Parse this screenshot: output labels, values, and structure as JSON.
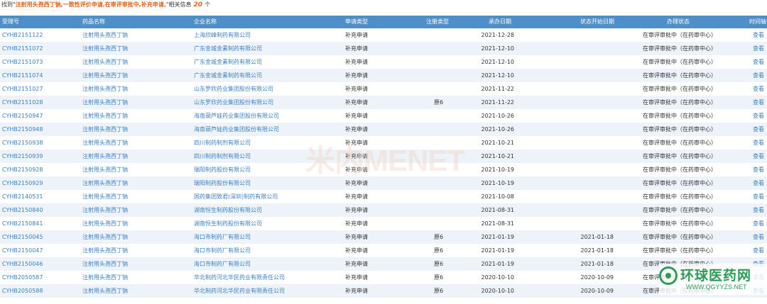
{
  "summary": {
    "prefix": "找到\"",
    "query": "注射用头孢西丁钠,一致性评价申请,在审评审批中,补充申请,",
    "suffix": "\"相关信息",
    "count": "20",
    "unit": "个"
  },
  "table": {
    "headers": [
      "受理号",
      "药品名称",
      "企业名称",
      "申请类型",
      "注册类型",
      "承办日期",
      "状态开始日期",
      "办理状态",
      "时间轴"
    ],
    "rows": [
      [
        "CYHB2151122",
        "注射用头孢西丁钠",
        "上海欣峰制药有限公司",
        "补充申请",
        "",
        "2021-12-28",
        "",
        "在审评审批中（在药审中心）",
        "查看"
      ],
      [
        "CYHB2151072",
        "注射用头孢西丁钠",
        "广东金城金素制药有限公司",
        "补充申请",
        "",
        "2021-12-10",
        "",
        "在审评审批中（在药审中心）",
        "查看"
      ],
      [
        "CYHB2151073",
        "注射用头孢西丁钠",
        "广东金城金素制药有限公司",
        "补充申请",
        "",
        "2021-12-10",
        "",
        "在审评审批中（在药审中心）",
        "查看"
      ],
      [
        "CYHB2151074",
        "注射用头孢西丁钠",
        "广东金城金素制药有限公司",
        "补充申请",
        "",
        "2021-12-10",
        "",
        "在审评审批中（在药审中心）",
        "查看"
      ],
      [
        "CYHB2151027",
        "注射用头孢西丁钠",
        "山东罗欣药业集团股份有限公司",
        "补充申请",
        "",
        "2021-11-22",
        "",
        "在审评审批中（在药审中心）",
        "查看"
      ],
      [
        "CYHB2151028",
        "注射用头孢西丁钠",
        "山东罗欣药业集团股份有限公司",
        "补充申请",
        "原6",
        "2021-11-22",
        "",
        "在审评审批中（在药审中心）",
        "查看"
      ],
      [
        "CYHB2150947",
        "注射用头孢西丁钠",
        "海南葫芦娃药业集团股份有限公司",
        "补充申请",
        "",
        "2021-10-26",
        "",
        "在审评审批中（在药审中心）",
        "查看"
      ],
      [
        "CYHB2150948",
        "注射用头孢西丁钠",
        "海南葫芦娃药业集团股份有限公司",
        "补充申请",
        "",
        "2021-10-26",
        "",
        "在审评审批中（在药审中心）",
        "查看"
      ],
      [
        "CYHB2150938",
        "注射用头孢西丁钠",
        "四川制药制剂有限公司",
        "补充申请",
        "",
        "2021-10-21",
        "",
        "在审评审批中（在药审中心）",
        "查看"
      ],
      [
        "CYHB2150939",
        "注射用头孢西丁钠",
        "四川制药制剂有限公司",
        "补充申请",
        "",
        "2021-10-21",
        "",
        "在审评审批中（在药审中心）",
        "查看"
      ],
      [
        "CYHB2150928",
        "注射用头孢西丁钠",
        "瑞阳制药股份有限公司",
        "补充申请",
        "",
        "2021-10-19",
        "",
        "在审评审批中（在药审中心）",
        "查看"
      ],
      [
        "CYHB2150929",
        "注射用头孢西丁钠",
        "瑞阳制药股份有限公司",
        "补充申请",
        "",
        "2021-10-19",
        "",
        "在审评审批中（在药审中心）",
        "查看"
      ],
      [
        "CYHB2140531",
        "注射用头孢西丁钠",
        "国药集团致君(深圳)制药有限公司",
        "补充申请",
        "",
        "2021-10-08",
        "",
        "在审评审批中（在药审中心）",
        "查看"
      ],
      [
        "CYHB2150840",
        "注射用头孢西丁钠",
        "湖南恒生制药股份有限公司",
        "补充申请",
        "",
        "2021-08-31",
        "",
        "在审评审批中（在药审中心）",
        "查看"
      ],
      [
        "CYHB2150841",
        "注射用头孢西丁钠",
        "湖南恒生制药股份有限公司",
        "补充申请",
        "",
        "2021-08-31",
        "",
        "在审评审批中（在药审中心）",
        "查看"
      ],
      [
        "CYHB2150045",
        "注射用头孢西丁钠",
        "海口市制药厂有限公司",
        "补充申请",
        "原6",
        "2021-01-19",
        "2021-01-18",
        "在审评审批中（在药审中心）",
        "查看"
      ],
      [
        "CYHB2150047",
        "注射用头孢西丁钠",
        "海口市制药厂有限公司",
        "补充申请",
        "原6",
        "2021-01-19",
        "2021-01-18",
        "在审评审批中（在药审中心）",
        "查看"
      ],
      [
        "CYHB2150046",
        "注射用头孢西丁钠",
        "海口市制药厂有限公司",
        "补充申请",
        "原6",
        "2021-01-19",
        "2021-01-18",
        "在审评审批中（在药审中心）",
        "查看"
      ],
      [
        "CYHB2050587",
        "注射用头孢西丁钠",
        "华北制药河北华民药业有限责任公司",
        "补充申请",
        "原6",
        "2020-10-10",
        "2020-10-09",
        "在审评审批中（在药审中心）",
        "查看"
      ],
      [
        "CYHB2050588",
        "注射用头孢西丁钠",
        "华北制药河北华民药业有限责任公司",
        "补充申请",
        "原6",
        "2020-10-10",
        "2020-10-09",
        "在审评审批中（在药审中心）",
        "查看"
      ]
    ]
  },
  "watermark": {
    "text": "米内MENET"
  },
  "logo": {
    "name": "环球医药网",
    "url": "WWW.QGYYZS.NET",
    "color": "#2e9b57"
  },
  "colors": {
    "header_bg": "#4f8fc9",
    "link": "#3a80c2",
    "highlight": "#e0621a",
    "stripe": "#edf3f9"
  }
}
